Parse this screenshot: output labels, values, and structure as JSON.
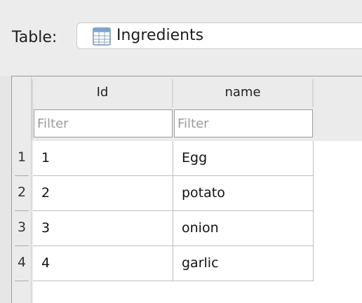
{
  "toolbar": {
    "table_label": "Table:",
    "table_name": "Ingredients",
    "table_icon": "table-icon"
  },
  "grid": {
    "columns": [
      {
        "header": "Id",
        "filter_placeholder": "Filter"
      },
      {
        "header": "name",
        "filter_placeholder": "Filter"
      }
    ],
    "rows": [
      {
        "num": "1",
        "id": "1",
        "name": "Egg"
      },
      {
        "num": "2",
        "id": "2",
        "name": "potato"
      },
      {
        "num": "3",
        "id": "3",
        "name": "onion"
      },
      {
        "num": "4",
        "id": "4",
        "name": "garlic"
      }
    ]
  },
  "colors": {
    "background": "#ececec",
    "cell_bg": "#ffffff",
    "grid_line": "#bdbdbd",
    "placeholder": "#9a9a9a"
  }
}
